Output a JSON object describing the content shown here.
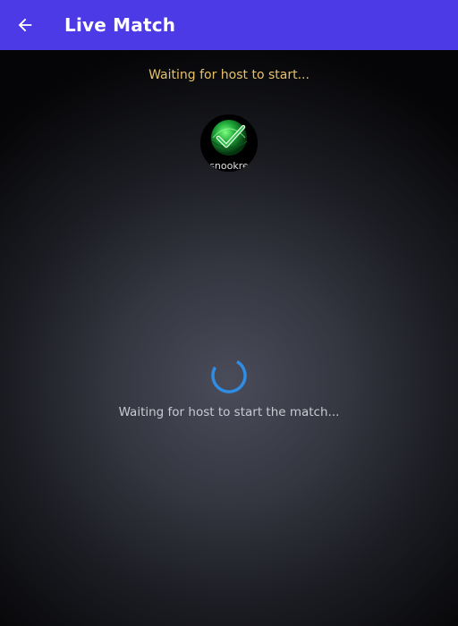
{
  "header": {
    "title": "Live Match",
    "background_color": "#4b3ae6",
    "back_icon": "arrow-left-icon"
  },
  "status": {
    "top_text": "Waiting for host to start...",
    "top_text_color": "#e6c06a",
    "bottom_text": "Waiting for host to start the match...",
    "bottom_text_color": "#c9cad3"
  },
  "host": {
    "avatar_text": "snookre",
    "avatar_icon": "green-checkmark-globe-logo-icon"
  },
  "loading": {
    "icon": "loading-spinner-icon",
    "color": "#2f8de6"
  }
}
